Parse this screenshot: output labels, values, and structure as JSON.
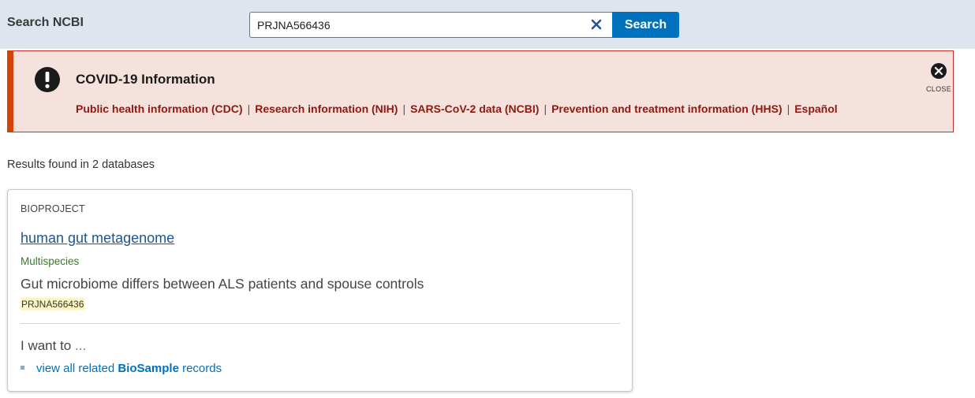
{
  "header": {
    "title": "Search NCBI",
    "search_value": "PRJNA566436",
    "search_button": "Search"
  },
  "alert": {
    "title": "COVID-19 Information",
    "links": [
      "Public health information (CDC)",
      "Research information (NIH)",
      "SARS-CoV-2 data (NCBI)",
      "Prevention and treatment information (HHS)",
      "Español"
    ],
    "separator": "|",
    "close_label": "CLOSE"
  },
  "results": {
    "count_text": "Results found in 2 databases"
  },
  "card": {
    "database": "BIOPROJECT",
    "title": "human gut metagenome",
    "organism": "Multispecies",
    "description": "Gut microbiome differs between ALS patients and spouse controls",
    "accession": "PRJNA566436",
    "iwant_label": "I want to",
    "iwant_ellipsis": "...",
    "related": {
      "prefix": "view all related",
      "db": "BioSample",
      "suffix": "records"
    }
  },
  "colors": {
    "topbar": "#dfe5ef",
    "search_button": "#0071bc",
    "alert_bg": "#f5e2dc",
    "alert_border": "#d54309",
    "alert_link": "#8b1a10",
    "link": "#205493",
    "organism": "#3b7a2a",
    "highlight": "#fdf6c3"
  },
  "icons": {
    "clear": "close-x-icon",
    "alert": "exclamation-circle-icon",
    "close": "close-circle-icon"
  }
}
